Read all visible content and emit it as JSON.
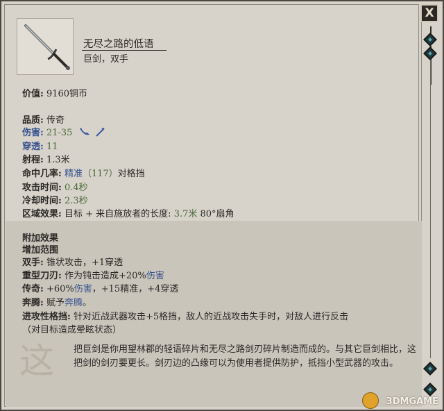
{
  "item": {
    "name": "无尽之路的低语",
    "type": "巨剑，双手",
    "icon": "greatsword-icon"
  },
  "close_label": "X",
  "stats": {
    "value_label": "价值:",
    "value": "9160铜币",
    "quality_label": "品质:",
    "quality": "传奇",
    "damage_label": "伤害:",
    "damage": "21-35",
    "damage_icons": [
      "slashing-icon",
      "piercing-icon"
    ],
    "penetration_label": "穿透:",
    "penetration": "11",
    "range_label": "射程:",
    "range": "1.3米",
    "accuracy_label": "命中几率:",
    "accuracy_word": "精准",
    "accuracy_value": "（117）",
    "accuracy_vs": "对格挡",
    "attack_time_label": "攻击时间:",
    "attack_time": "0.4秒",
    "recovery_label": "冷却时间:",
    "recovery": "2.3秒",
    "aoe_label": "区域效果:",
    "aoe_target": "目标",
    "aoe_plus": "+",
    "aoe_from": "来自施放者的长度:",
    "aoe_length": "3.7米",
    "aoe_angle": "80°扇角"
  },
  "effects": {
    "header": "附加效果",
    "reach": "增加范围",
    "two_hand_label": "双手:",
    "two_hand": "锥状攻击，+1穿透",
    "heavy_label": "重型刀刃:",
    "heavy_a": "作为钝击造成+20%",
    "heavy_b": "伤害",
    "legendary_label": "传奇:",
    "legendary_a": "+60%",
    "legendary_b": "伤害",
    "legendary_c": "，+15精准，+4穿透",
    "rush_label": "奔腾:",
    "rush_a": "赋予",
    "rush_b": "奔腾",
    "rush_c": "。",
    "riposte_label": "进攻性格挡:",
    "riposte": "针对近战武器攻击+5格挡，敌人的近战攻击失手时，对敌人进行反击",
    "riposte2": "（对目标造成晕眩状态）"
  },
  "description": "把巨剑是你用望林郡的轻语碎片和无尽之路剑刃碎片制造而成的。与其它巨剑相比，这把剑的剑刃要更长。剑刃边的凸缘可以为使用者提供防护，抵挡小型武器的攻击。",
  "emblem": "这",
  "watermark": "3DMGAME",
  "colors": {
    "keyword_blue": "#36518f",
    "value_green": "#4a6a38",
    "panel_bg": "#d7d3ca"
  }
}
